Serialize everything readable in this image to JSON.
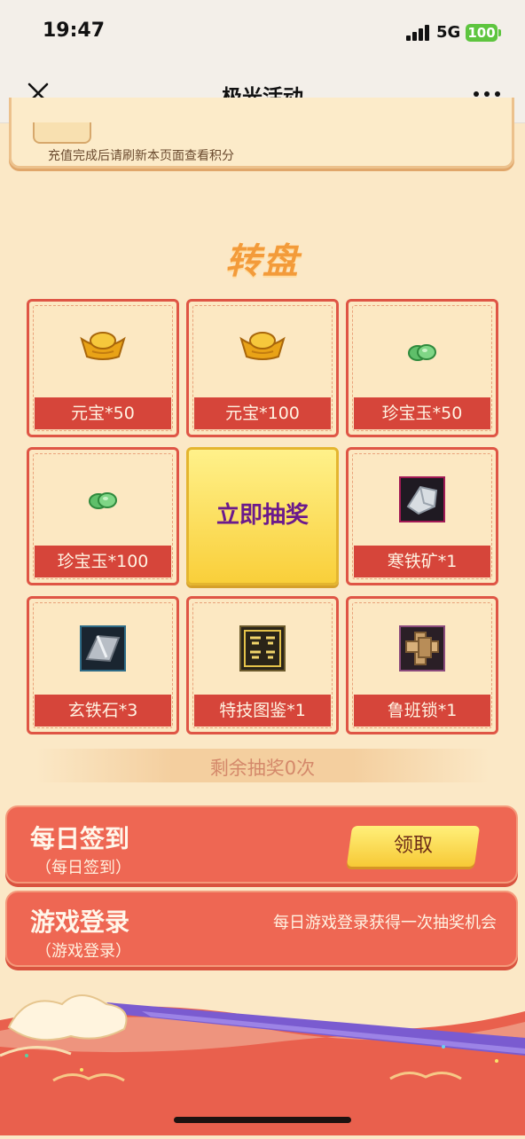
{
  "status_bar": {
    "time": "19:47",
    "network": "5G",
    "battery": "100"
  },
  "nav": {
    "title": "极光活动",
    "close_icon": "close-icon",
    "more_icon": "more-icon"
  },
  "notice": {
    "text": "充值完成后请刷新本页面查看积分"
  },
  "wheel": {
    "title": "转盘",
    "draw_button": "立即抽奖",
    "prizes": [
      {
        "label": "元宝*50",
        "icon": "gold-ingot-icon"
      },
      {
        "label": "元宝*100",
        "icon": "gold-ingot-icon"
      },
      {
        "label": "珍宝玉*50",
        "icon": "jade-icon"
      },
      {
        "label": "珍宝玉*100",
        "icon": "jade-icon"
      },
      {
        "label": "寒铁矿*1",
        "icon": "cold-iron-ore-icon"
      },
      {
        "label": "玄铁石*3",
        "icon": "dark-iron-stone-icon"
      },
      {
        "label": "特技图鉴*1",
        "icon": "skill-book-icon"
      },
      {
        "label": "鲁班锁*1",
        "icon": "luban-lock-icon"
      }
    ],
    "remaining": "剩余抽奖0次"
  },
  "tasks": [
    {
      "title": "每日签到",
      "subtitle": "（每日签到）",
      "button": "领取"
    },
    {
      "title": "游戏登录",
      "subtitle": "（游戏登录）",
      "description": "每日游戏登录获得一次抽奖机会"
    }
  ],
  "colors": {
    "accent_red": "#d6453a",
    "panel_red": "#ee6753",
    "gold": "#f9cf3a",
    "draw_text": "#6b1a8c"
  }
}
